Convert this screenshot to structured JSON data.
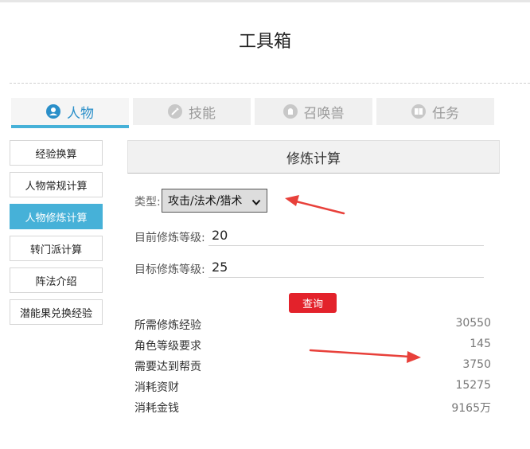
{
  "page": {
    "title": "工具箱"
  },
  "tabs": [
    {
      "label": "人物",
      "icon": "user-icon",
      "active": true
    },
    {
      "label": "技能",
      "icon": "skill-icon",
      "active": false
    },
    {
      "label": "召唤兽",
      "icon": "summon-icon",
      "active": false
    },
    {
      "label": "任务",
      "icon": "book-icon",
      "active": false
    }
  ],
  "sidebar": {
    "items": [
      {
        "label": "经验换算",
        "active": false
      },
      {
        "label": "人物常规计算",
        "active": false
      },
      {
        "label": "人物修炼计算",
        "active": true
      },
      {
        "label": "转门派计算",
        "active": false
      },
      {
        "label": "阵法介绍",
        "active": false
      },
      {
        "label": "潜能果兑换经验",
        "active": false
      }
    ]
  },
  "panel": {
    "title": "修炼计算",
    "type_label": "类型:",
    "type_value": "攻击/法术/猎术",
    "current_label": "目前修炼等级:",
    "current_value": "20",
    "target_label": "目标修炼等级:",
    "target_value": "25",
    "query_label": "查询"
  },
  "results": [
    {
      "label": "所需修炼经验",
      "value": "30550"
    },
    {
      "label": "角色等级要求",
      "value": "145"
    },
    {
      "label": "需要达到帮贡",
      "value": "3750"
    },
    {
      "label": "消耗资财",
      "value": "15275"
    },
    {
      "label": "消耗金钱",
      "value": "9165万"
    }
  ],
  "colors": {
    "accent": "#46b1d8",
    "tab_active_text": "#2a8fc9",
    "button_red": "#e3222b",
    "annotation_arrow": "#e8403a"
  }
}
